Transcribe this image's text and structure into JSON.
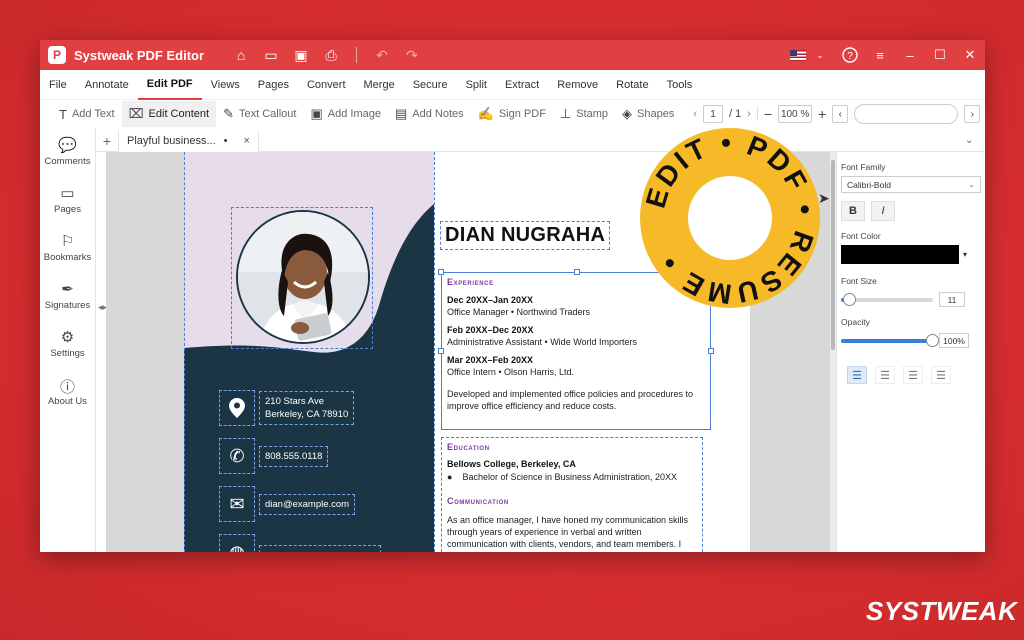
{
  "app": {
    "title": "Systweak PDF Editor",
    "logo_letter": "P"
  },
  "titlebar_icons": [
    "home-icon",
    "folder-icon",
    "save-icon",
    "print-icon",
    "undo-icon",
    "redo-icon"
  ],
  "menu": {
    "items": [
      "File",
      "Annotate",
      "Edit PDF",
      "Views",
      "Pages",
      "Convert",
      "Merge",
      "Secure",
      "Split",
      "Extract",
      "Remove",
      "Rotate",
      "Tools"
    ],
    "active": "Edit PDF"
  },
  "toolbar": {
    "tools": [
      {
        "label": "Add Text",
        "icon": "T"
      },
      {
        "label": "Edit Content",
        "icon": "⌧"
      },
      {
        "label": "Text Callout",
        "icon": "✎"
      },
      {
        "label": "Add Image",
        "icon": "▣"
      },
      {
        "label": "Add Notes",
        "icon": "▤"
      },
      {
        "label": "Sign PDF",
        "icon": "✍"
      },
      {
        "label": "Stamp",
        "icon": "⊥"
      },
      {
        "label": "Shapes",
        "icon": "◈"
      }
    ],
    "page_current": "1",
    "page_total": "/ 1",
    "zoom": "100 %"
  },
  "tab": {
    "name": "Playful business...",
    "modified_mark": "•",
    "close": "×"
  },
  "sidebar": {
    "items": [
      {
        "label": "Comments",
        "icon": "comments-icon",
        "glyph": "💬"
      },
      {
        "label": "Pages",
        "icon": "pages-icon",
        "glyph": "▭"
      },
      {
        "label": "Bookmarks",
        "icon": "bookmark-icon",
        "glyph": "⚐"
      },
      {
        "label": "Signatures",
        "icon": "signature-icon",
        "glyph": "✒"
      },
      {
        "label": "Settings",
        "icon": "gear-icon",
        "glyph": "⚙"
      },
      {
        "label": "About Us",
        "icon": "info-icon",
        "glyph": "ⓘ"
      }
    ]
  },
  "resume": {
    "name": "DIAN NUGRAHA",
    "contact": {
      "address_line1": "210 Stars Ave",
      "address_line2": "Berkeley, CA 78910",
      "phone": "808.555.0118",
      "email": "dian@example.com"
    },
    "experience_title": "Experience",
    "jobs": [
      {
        "dates": "Dec 20XX–Jan 20XX",
        "role": "Office Manager • Northwind Traders"
      },
      {
        "dates": "Feb 20XX–Dec 20XX",
        "role": "Administrative Assistant • Wide World Importers"
      },
      {
        "dates": "Mar 20XX–Feb 20XX",
        "role": "Office Intern • Olson Harris, Ltd."
      }
    ],
    "experience_para": "Developed and implemented office policies and procedures to improve office efficiency and reduce costs.",
    "education_title": "Education",
    "school": "Bellows College, Berkeley, CA",
    "degree": "Bachelor of Science in Business Administration, 20XX",
    "communication_title": "Communication",
    "communication_para": "As an office manager, I have honed my communication skills through years of experience in verbal and written communication with clients, vendors, and team members. I"
  },
  "properties": {
    "font_family_label": "Font Family",
    "font_family_value": "Calibri-Bold",
    "bold": "B",
    "italic": "I",
    "font_color_label": "Font Color",
    "font_color": "#000000",
    "font_size_label": "Font Size",
    "font_size": "11",
    "font_size_level": 0.1,
    "opacity_label": "Opacity",
    "opacity": "100%",
    "opacity_level": 1.0,
    "alignments": [
      "align-left",
      "align-center",
      "align-right",
      "align-justify"
    ],
    "active_alignment": "align-left"
  },
  "badge": {
    "text": "EDIT • PDF • RESUME •",
    "color": "#f6b928"
  },
  "brand": {
    "text": "SYSTWEAK"
  },
  "colors": {
    "accent": "#e04042",
    "background": "#d92f31",
    "resume_dark": "#1b3544",
    "resume_lilac": "#e7dcea",
    "section_purple": "#7a3a9a"
  }
}
